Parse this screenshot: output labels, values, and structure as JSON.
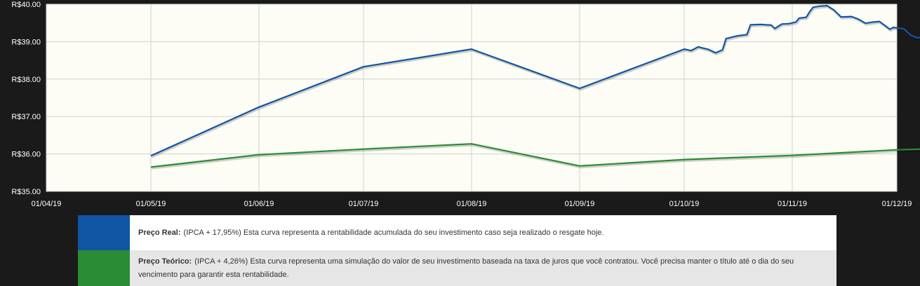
{
  "chart_data": {
    "type": "line",
    "x_ticks": [
      "01/04/19",
      "01/05/19",
      "01/06/19",
      "01/07/19",
      "01/08/19",
      "01/09/19",
      "01/10/19",
      "01/11/19",
      "01/12/19"
    ],
    "y_ticks": [
      "R$35.00",
      "R$36.00",
      "R$37.00",
      "R$38.00",
      "R$39.00",
      "R$40.00"
    ],
    "ylim": [
      35.0,
      40.0
    ],
    "xlim": [
      "2019-04-01",
      "2019-12-01"
    ],
    "grid": true,
    "series": [
      {
        "name": "Preço Real",
        "color": "#1155a5",
        "points": [
          [
            "2019-05-01",
            35.95
          ],
          [
            "2019-06-01",
            37.25
          ],
          [
            "2019-07-01",
            38.33
          ],
          [
            "2019-08-01",
            38.8
          ],
          [
            "2019-09-01",
            37.75
          ],
          [
            "2019-10-01",
            38.8
          ],
          [
            "2019-10-03",
            38.76
          ],
          [
            "2019-10-05",
            38.86
          ],
          [
            "2019-10-08",
            38.79
          ],
          [
            "2019-10-10",
            38.7
          ],
          [
            "2019-10-12",
            38.78
          ],
          [
            "2019-10-13",
            39.08
          ],
          [
            "2019-10-16",
            39.15
          ],
          [
            "2019-10-19",
            39.19
          ],
          [
            "2019-10-20",
            39.45
          ],
          [
            "2019-10-23",
            39.46
          ],
          [
            "2019-10-26",
            39.44
          ],
          [
            "2019-10-27",
            39.35
          ],
          [
            "2019-10-29",
            39.47
          ],
          [
            "2019-10-31",
            39.48
          ],
          [
            "2019-11-02",
            39.52
          ],
          [
            "2019-11-03",
            39.63
          ],
          [
            "2019-11-05",
            39.65
          ],
          [
            "2019-11-06",
            39.8
          ],
          [
            "2019-11-07",
            39.92
          ],
          [
            "2019-11-09",
            39.95
          ],
          [
            "2019-11-11",
            39.96
          ],
          [
            "2019-11-13",
            39.84
          ],
          [
            "2019-11-15",
            39.66
          ],
          [
            "2019-11-18",
            39.67
          ],
          [
            "2019-11-20",
            39.6
          ],
          [
            "2019-11-22",
            39.49
          ],
          [
            "2019-11-24",
            39.52
          ],
          [
            "2019-11-26",
            39.54
          ],
          [
            "2019-11-28",
            39.4
          ],
          [
            "2019-11-29",
            39.33
          ],
          [
            "2019-11-30",
            39.38
          ],
          [
            "2019-12-03",
            39.34
          ],
          [
            "2019-12-05",
            39.17
          ],
          [
            "2019-12-07",
            39.1
          ],
          [
            "2019-12-08",
            39.12
          ],
          [
            "2019-12-09",
            39.2
          ]
        ]
      },
      {
        "name": "Preço Teórico",
        "color": "#2a8c35",
        "points": [
          [
            "2019-05-01",
            35.65
          ],
          [
            "2019-06-01",
            35.98
          ],
          [
            "2019-07-01",
            36.13
          ],
          [
            "2019-08-01",
            36.27
          ],
          [
            "2019-09-01",
            35.68
          ],
          [
            "2019-10-01",
            35.85
          ],
          [
            "2019-10-15",
            35.9
          ],
          [
            "2019-11-01",
            35.96
          ],
          [
            "2019-11-15",
            36.03
          ],
          [
            "2019-12-01",
            36.11
          ],
          [
            "2019-12-09",
            36.13
          ]
        ]
      }
    ]
  },
  "legend": {
    "real": {
      "color": "#1155a5",
      "label": "Preço Real:",
      "text": "(IPCA + 17,95%) Esta curva representa a rentabilidade acumulada do seu investimento caso seja realizado o resgate hoje."
    },
    "teorico": {
      "color": "#2a8c35",
      "label": "Preço Teórico:",
      "text": "(IPCA + 4,26%) Esta curva representa uma simulação do valor de seu investimento baseada na taxa de juros que você contratou. Você precisa manter o título até o dia do seu vencimento para garantir esta rentabilidade."
    }
  }
}
